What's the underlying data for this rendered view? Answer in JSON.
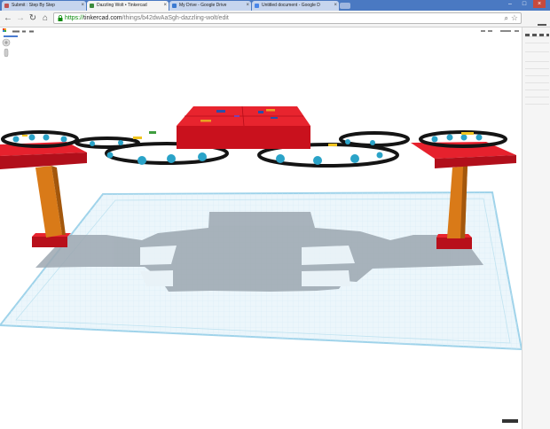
{
  "browser": {
    "tabs": [
      {
        "title": "Submit : Step By Step",
        "fav": "#c05353"
      },
      {
        "title": "Dazzling Wolt • Tinkercad",
        "fav": "#3d8b3d"
      },
      {
        "title": "My Drive - Google Drive",
        "fav": "#3b7ad1"
      },
      {
        "title": "Untitled document - Google D",
        "fav": "#4a86e8"
      }
    ],
    "close_glyph": "×",
    "url": {
      "scheme": "https://",
      "host": "tinkercad.com",
      "path": "/things/b42dwAaSgh-dazzling-wolt/edit"
    },
    "icons": {
      "back": "←",
      "forward": "→",
      "reload": "↻",
      "home": "⌂",
      "search": "⌕",
      "star": "☆"
    },
    "window_controls": {
      "minimize": "–",
      "maximize": "□",
      "close": "×"
    }
  },
  "colors": {
    "chrome_blue": "#4a79c2",
    "red": "#e01c2c",
    "orange": "#d9760f",
    "cyan": "#2ea7c9",
    "grid": "#cfe9f5",
    "shadow": "#9aa6b0"
  }
}
